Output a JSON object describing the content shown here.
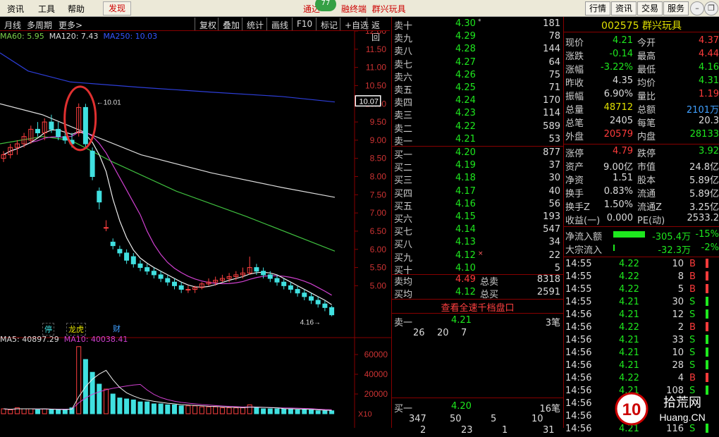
{
  "menu": {
    "items": [
      "资讯",
      "工具",
      "帮助"
    ],
    "find": "发现",
    "title_prefix": "通达",
    "title_mid": "融终端",
    "stock_title": "群兴玩具",
    "badge": "77",
    "right_buttons": [
      "行情",
      "资讯",
      "交易",
      "服务"
    ]
  },
  "toolbar": {
    "label_period": "月线",
    "label_multi": "多周期",
    "label_more": "更多",
    "buttons": [
      "复权",
      "叠加",
      "统计",
      "画线",
      "F10",
      "标记",
      "+自选",
      "返回"
    ]
  },
  "legend": {
    "ma60": "MA60: 5.95",
    "ma120": "MA120: 7.43",
    "ma250": "MA250: 10.03"
  },
  "price_axis": {
    "ticks": [
      "12.00",
      "11.50",
      "11.00",
      "10.50",
      "10.00",
      "9.50",
      "9.00",
      "8.50",
      "8.00",
      "7.50",
      "7.00",
      "6.50",
      "6.00",
      "5.50",
      "5.00"
    ],
    "current_label": "10.07"
  },
  "annotations": {
    "high_label": "10.01",
    "low_label": "4.16",
    "badge_ting": "停",
    "badge_longhu": "龙虎",
    "badge_cai": "财"
  },
  "volume": {
    "ma5": "MA5: 40897.29",
    "ma10": "MA10: 40038.41",
    "ticks": [
      "60000",
      "40000",
      "20000"
    ],
    "unit": "X10"
  },
  "chart_data": {
    "type": "candlestick",
    "period": "monthly",
    "price_ylim": [
      4.0,
      12.0
    ],
    "candles": [
      [
        8.5,
        8.7,
        8.4,
        8.6
      ],
      [
        8.6,
        8.9,
        8.5,
        8.8
      ],
      [
        8.8,
        9.0,
        8.6,
        8.9
      ],
      [
        8.9,
        9.2,
        8.8,
        9.1
      ],
      [
        9.0,
        9.4,
        8.9,
        9.3
      ],
      [
        9.3,
        9.5,
        9.1,
        9.2
      ],
      [
        9.2,
        9.6,
        9.0,
        9.5
      ],
      [
        9.5,
        9.7,
        9.2,
        9.3
      ],
      [
        9.3,
        9.5,
        9.0,
        9.1
      ],
      [
        9.1,
        9.3,
        8.9,
        9.0
      ],
      [
        9.0,
        9.2,
        8.8,
        8.9
      ],
      [
        9.2,
        10.01,
        9.1,
        9.9
      ],
      [
        9.9,
        10.0,
        8.8,
        8.9
      ],
      [
        8.7,
        8.8,
        7.9,
        8.0
      ],
      [
        7.6,
        7.7,
        7.1,
        7.3
      ],
      [
        6.6,
        6.8,
        6.5,
        6.6
      ],
      [
        6.2,
        6.3,
        6.0,
        6.1
      ],
      [
        6.0,
        6.1,
        5.8,
        5.9
      ],
      [
        5.9,
        6.0,
        5.6,
        5.7
      ],
      [
        5.8,
        5.9,
        5.5,
        5.6
      ],
      [
        5.6,
        5.7,
        5.4,
        5.5
      ],
      [
        5.5,
        5.6,
        5.3,
        5.4
      ],
      [
        5.4,
        5.5,
        5.2,
        5.3
      ],
      [
        5.3,
        5.4,
        5.1,
        5.2
      ],
      [
        5.2,
        5.3,
        5.0,
        5.1
      ],
      [
        5.1,
        5.2,
        4.9,
        5.0
      ],
      [
        5.0,
        5.1,
        4.8,
        4.9
      ],
      [
        4.9,
        5.0,
        4.8,
        4.9
      ],
      [
        4.9,
        5.0,
        4.8,
        4.95
      ],
      [
        4.95,
        5.1,
        4.9,
        5.05
      ],
      [
        5.05,
        5.2,
        5.0,
        5.1
      ],
      [
        5.1,
        5.25,
        5.0,
        5.15
      ],
      [
        5.15,
        5.3,
        5.1,
        5.2
      ],
      [
        5.2,
        5.35,
        5.1,
        5.25
      ],
      [
        5.25,
        5.4,
        5.15,
        5.3
      ],
      [
        5.3,
        5.5,
        5.2,
        5.35
      ],
      [
        5.35,
        5.8,
        5.3,
        5.5
      ],
      [
        5.5,
        5.6,
        5.3,
        5.4
      ],
      [
        5.4,
        5.5,
        5.2,
        5.3
      ],
      [
        5.3,
        5.4,
        5.1,
        5.2
      ],
      [
        5.2,
        5.3,
        5.0,
        5.1
      ],
      [
        5.1,
        5.2,
        4.9,
        5.0
      ],
      [
        5.0,
        5.1,
        4.8,
        4.9
      ],
      [
        4.9,
        5.0,
        4.7,
        4.8
      ],
      [
        4.8,
        4.9,
        4.6,
        4.7
      ],
      [
        4.7,
        4.8,
        4.5,
        4.6
      ],
      [
        4.6,
        4.7,
        4.4,
        4.5
      ],
      [
        4.5,
        4.6,
        4.3,
        4.4
      ],
      [
        4.4,
        4.45,
        4.16,
        4.2
      ]
    ],
    "ma250": [
      [
        0,
        11.4
      ],
      [
        40,
        10.9
      ],
      [
        100,
        10.6
      ],
      [
        200,
        10.45
      ],
      [
        300,
        10.32
      ],
      [
        400,
        10.2
      ],
      [
        475,
        10.05
      ]
    ],
    "ma120": [
      [
        0,
        10.0
      ],
      [
        60,
        9.7
      ],
      [
        110,
        9.3
      ],
      [
        200,
        8.6
      ],
      [
        300,
        8.1
      ],
      [
        400,
        7.7
      ],
      [
        475,
        7.43
      ]
    ],
    "ma60": [
      [
        0,
        8.9
      ],
      [
        60,
        9.1
      ],
      [
        100,
        9.0
      ],
      [
        160,
        8.4
      ],
      [
        250,
        7.6
      ],
      [
        350,
        6.9
      ],
      [
        475,
        5.95
      ]
    ],
    "volume_values": [
      5000,
      4000,
      6000,
      5000,
      5000,
      4000,
      5000,
      4000,
      4000,
      4000,
      6000,
      68000,
      55000,
      42000,
      30000,
      25000,
      20000,
      16000,
      15000,
      14000,
      12000,
      12000,
      10000,
      10000,
      9000,
      9000,
      8000,
      8000,
      8000,
      7000,
      7000,
      7000,
      6000,
      6000,
      6000,
      6000,
      9000,
      6000,
      5000,
      5000,
      5000,
      5000,
      5000,
      4000,
      4000,
      4000,
      3000,
      3000,
      3000
    ],
    "volume_ylim": [
      0,
      70000
    ]
  },
  "order_book": {
    "sells": [
      {
        "label": "卖十",
        "price": "4.30",
        "vol": "181",
        "mark": "*"
      },
      {
        "label": "卖九",
        "price": "4.29",
        "vol": "78"
      },
      {
        "label": "卖八",
        "price": "4.28",
        "vol": "144"
      },
      {
        "label": "卖七",
        "price": "4.27",
        "vol": "64"
      },
      {
        "label": "卖六",
        "price": "4.26",
        "vol": "75"
      },
      {
        "label": "卖五",
        "price": "4.25",
        "vol": "71"
      },
      {
        "label": "卖四",
        "price": "4.24",
        "vol": "170"
      },
      {
        "label": "卖三",
        "price": "4.23",
        "vol": "114"
      },
      {
        "label": "卖二",
        "price": "4.22",
        "vol": "589"
      },
      {
        "label": "卖一",
        "price": "4.21",
        "vol": "53"
      }
    ],
    "buys": [
      {
        "label": "买一",
        "price": "4.20",
        "vol": "877"
      },
      {
        "label": "买二",
        "price": "4.19",
        "vol": "37"
      },
      {
        "label": "买三",
        "price": "4.18",
        "vol": "30"
      },
      {
        "label": "买四",
        "price": "4.17",
        "vol": "40"
      },
      {
        "label": "买五",
        "price": "4.16",
        "vol": "56"
      },
      {
        "label": "买六",
        "price": "4.15",
        "vol": "193"
      },
      {
        "label": "买七",
        "price": "4.14",
        "vol": "547"
      },
      {
        "label": "买八",
        "price": "4.13",
        "vol": "34"
      },
      {
        "label": "买九",
        "price": "4.12",
        "vol": "22",
        "mark": "×"
      },
      {
        "label": "买十",
        "price": "4.10",
        "vol": "5"
      }
    ],
    "sell_avg_label": "卖均",
    "sell_avg": "4.49",
    "sell_total_label": "总卖",
    "sell_total": "8318",
    "buy_avg_label": "买均",
    "buy_avg": "4.12",
    "buy_total_label": "总买",
    "buy_total": "2591",
    "quick_link": "查看全速千档盘口",
    "queue_sell": {
      "label": "卖一",
      "price": "4.21",
      "count": "3笔",
      "orders": [
        "26",
        "20",
        "7"
      ]
    },
    "queue_buy": {
      "label": "买一",
      "price": "4.20",
      "count": "16笔",
      "orders": [
        "347",
        "50",
        "5",
        "10"
      ]
    },
    "queue_buy_row2": [
      "2",
      "23",
      "1",
      "31"
    ]
  },
  "info": {
    "code": "002575",
    "name": "群兴玩具",
    "rows1": [
      {
        "l1": "现价",
        "v1": "4.21",
        "c1": "grn",
        "l2": "今开",
        "v2": "4.37",
        "c2": "red"
      },
      {
        "l1": "涨跌",
        "v1": "-0.14",
        "c1": "grn",
        "l2": "最高",
        "v2": "4.44",
        "c2": "red"
      },
      {
        "l1": "涨幅",
        "v1": "-3.22%",
        "c1": "grn",
        "l2": "最低",
        "v2": "4.16",
        "c2": "grn"
      },
      {
        "l1": "昨收",
        "v1": "4.35",
        "c1": "wht",
        "l2": "均价",
        "v2": "4.31",
        "c2": "grn"
      },
      {
        "l1": "振幅",
        "v1": "6.90%",
        "c1": "wht",
        "l2": "量比",
        "v2": "1.19",
        "c2": "red"
      },
      {
        "l1": "总量",
        "v1": "48712",
        "c1": "yel",
        "l2": "总额",
        "v2": "2101万",
        "c2": "cyn"
      },
      {
        "l1": "总笔",
        "v1": "2405",
        "c1": "wht",
        "l2": "每笔",
        "v2": "20.3",
        "c2": "wht"
      },
      {
        "l1": "外盘",
        "v1": "20579",
        "c1": "red",
        "l2": "内盘",
        "v2": "28133",
        "c2": "grn"
      }
    ],
    "rows2": [
      {
        "l1": "涨停",
        "v1": "4.79",
        "c1": "red",
        "l2": "跌停",
        "v2": "3.92",
        "c2": "grn"
      },
      {
        "l1": "资产",
        "v1": "9.00亿",
        "c1": "wht",
        "l2": "市值",
        "v2": "24.8亿",
        "c2": "wht"
      },
      {
        "l1": "净资",
        "v1": "1.51",
        "c1": "wht",
        "l2": "股本",
        "v2": "5.89亿",
        "c2": "wht"
      },
      {
        "l1": "换手",
        "v1": "0.83%",
        "c1": "wht",
        "l2": "流通",
        "v2": "5.89亿",
        "c2": "wht"
      },
      {
        "l1": "换手Z",
        "v1": "1.50%",
        "c1": "wht",
        "l2": "流通Z",
        "v2": "3.25亿",
        "c2": "wht"
      },
      {
        "l1": "收益(一)",
        "v1": "0.000",
        "c1": "wht",
        "l2": "PE(动)",
        "v2": "2533.2",
        "c2": "wht"
      }
    ],
    "net_inflow": {
      "label": "净流入额",
      "value": "-305.4万",
      "pct": "-15%",
      "bar_fraction": 0.6
    },
    "block_inflow": {
      "label": "大宗流入",
      "value": "-32.3万",
      "pct": "-2%",
      "bar_fraction": 0.03
    },
    "ticks": [
      {
        "t": "14:55",
        "p": "4.22",
        "v": "10",
        "d": "B"
      },
      {
        "t": "14:55",
        "p": "4.22",
        "v": "8",
        "d": "B"
      },
      {
        "t": "14:55",
        "p": "4.22",
        "v": "5",
        "d": "B"
      },
      {
        "t": "14:55",
        "p": "4.21",
        "v": "30",
        "d": "S"
      },
      {
        "t": "14:56",
        "p": "4.21",
        "v": "12",
        "d": "S"
      },
      {
        "t": "14:56",
        "p": "4.22",
        "v": "2",
        "d": "B"
      },
      {
        "t": "14:56",
        "p": "4.21",
        "v": "33",
        "d": "S"
      },
      {
        "t": "14:56",
        "p": "4.21",
        "v": "10",
        "d": "S"
      },
      {
        "t": "14:56",
        "p": "4.21",
        "v": "28",
        "d": "S"
      },
      {
        "t": "14:56",
        "p": "4.22",
        "v": "4",
        "d": "B"
      },
      {
        "t": "14:56",
        "p": "4.21",
        "v": "108",
        "d": "S"
      },
      {
        "t": "14:56",
        "p": "4.21",
        "v": "",
        "d": ""
      },
      {
        "t": "14:56",
        "p": "4.22",
        "v": "",
        "d": ""
      },
      {
        "t": "14:56",
        "p": "4.21",
        "v": "116",
        "d": "S"
      }
    ]
  },
  "watermark": {
    "logo_text": "10",
    "site_cn": "拾荒网",
    "site_en": "Huang.CN"
  }
}
